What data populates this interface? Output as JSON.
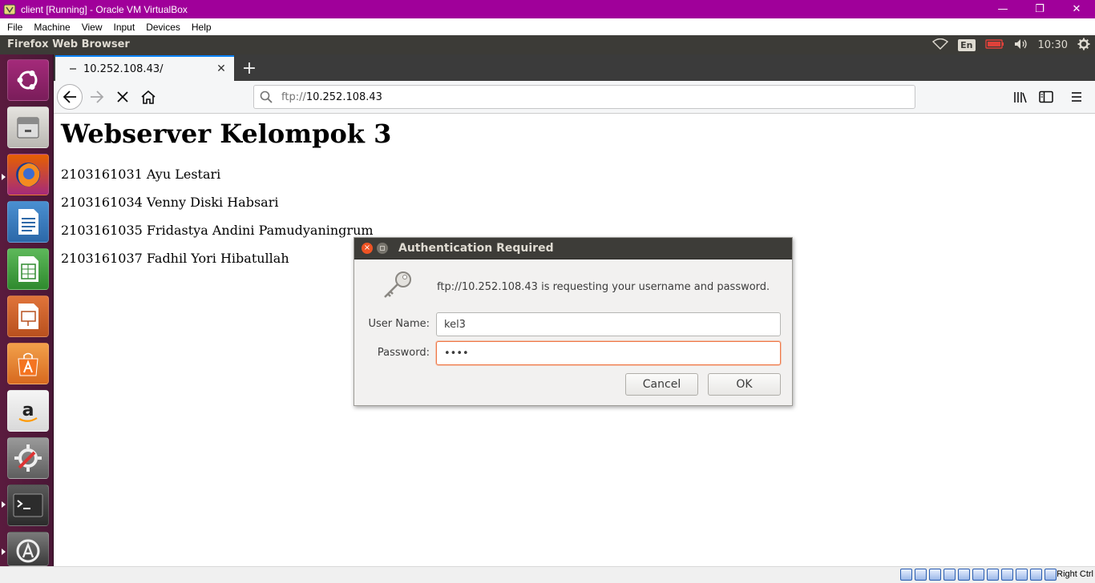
{
  "vbox": {
    "window_title": "client [Running] - Oracle VM VirtualBox",
    "window_controls": {
      "minimize": "—",
      "restore": "❐",
      "close": "✕"
    },
    "menu": [
      "File",
      "Machine",
      "View",
      "Input",
      "Devices",
      "Help"
    ],
    "status_bar": {
      "host_key": "Right Ctrl",
      "icon_count": 11
    }
  },
  "ubuntu_panel": {
    "app_title": "Firefox Web Browser",
    "keyboard_layout": "En",
    "clock": "10:30"
  },
  "launcher": {
    "items": [
      "ubuntu-dash-icon",
      "files-icon",
      "firefox-icon",
      "writer-icon",
      "calc-icon",
      "impress-icon",
      "software-center-icon",
      "amazon-icon",
      "system-settings-icon",
      "terminal-icon",
      "software-updater-icon"
    ]
  },
  "firefox": {
    "tab": {
      "title": "10.252.108.43/",
      "close_glyph": "✕"
    },
    "new_tab_glyph": "+",
    "url": {
      "scheme": "ftp://",
      "host": "10.252.108.43"
    },
    "accent_color": "#0a84ff"
  },
  "page": {
    "heading": "Webserver Kelompok 3",
    "members": [
      "2103161031 Ayu Lestari",
      "2103161034 Venny Diski Habsari",
      "2103161035 Fridastya Andini Pamudyaningrum",
      "2103161037 Fadhil Yori Hibatullah"
    ]
  },
  "auth_dialog": {
    "title": "Authentication Required",
    "message": "ftp://10.252.108.43 is requesting your username and password.",
    "username_label": "User Name:",
    "username_value": "kel3",
    "password_label": "Password:",
    "password_value": "••••",
    "cancel_label": "Cancel",
    "ok_label": "OK",
    "focus_color": "#f07746"
  }
}
